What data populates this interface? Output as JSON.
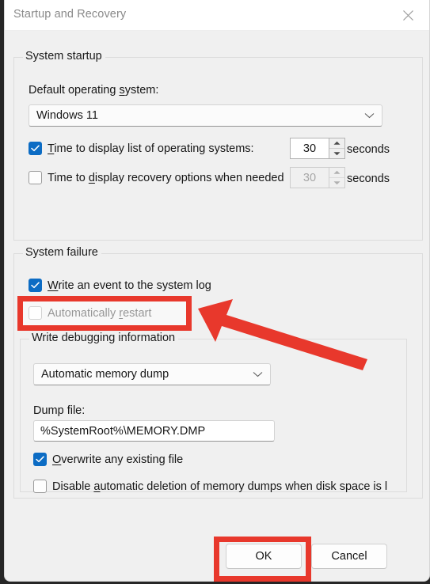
{
  "window": {
    "title": "Startup and Recovery",
    "close_icon": "close-icon"
  },
  "system_startup": {
    "legend": "System startup",
    "default_os_label_pre": "Default operating ",
    "default_os_label_key": "s",
    "default_os_label_post": "ystem:",
    "default_os_value": "Windows 11",
    "timeout_os": {
      "label_key": "T",
      "label_post": "ime to display list of operating systems:",
      "checked": true,
      "value": "30",
      "unit": "seconds"
    },
    "timeout_recovery": {
      "label_pre": "Time to ",
      "label_key": "d",
      "label_post": "isplay recovery options when needed",
      "checked": false,
      "value": "30",
      "unit": "seconds"
    }
  },
  "system_failure": {
    "legend": "System failure",
    "write_event": {
      "label_key": "W",
      "label_post": "rite an event to the system log",
      "checked": true
    },
    "auto_restart": {
      "label_pre": "Automatically ",
      "label_key": "r",
      "label_post": "estart",
      "checked": false
    },
    "write_debug": {
      "legend": "Write debugging information",
      "dump_type_value": "Automatic memory dump",
      "dump_file_label": "Dump file:",
      "dump_file_value": "%SystemRoot%\\MEMORY.DMP",
      "overwrite": {
        "label_key": "O",
        "label_post": "verwrite any existing file",
        "checked": true
      },
      "disable_deletion": {
        "label_pre": "Disable ",
        "label_key": "a",
        "label_post": "utomatic deletion of memory dumps when disk space is l",
        "checked": false
      }
    }
  },
  "footer": {
    "ok_label": "OK",
    "cancel_label": "Cancel"
  },
  "annotations": {
    "color": "#e8382c",
    "highlight_auto_restart": "Automatically restart",
    "highlight_ok": "OK"
  }
}
